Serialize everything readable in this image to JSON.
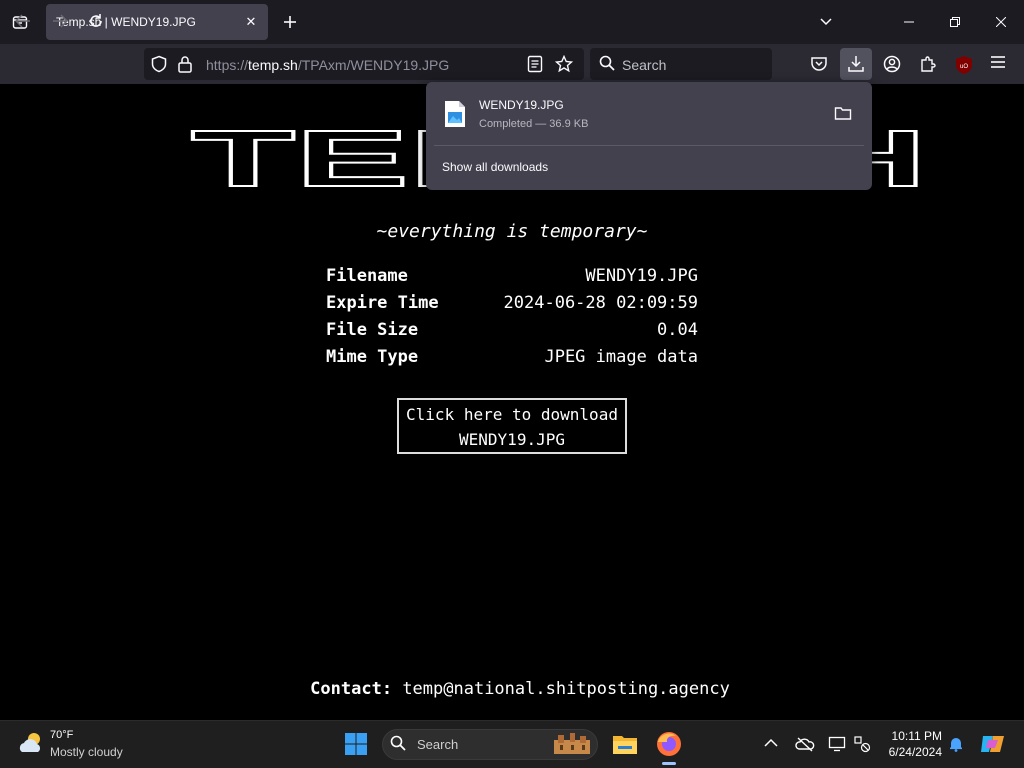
{
  "browser": {
    "tab_title": "Temp.sh | WENDY19.JPG",
    "url_prefix": "https://",
    "url_host": "temp.sh",
    "url_path": "/TPAxm/WENDY19.JPG",
    "search_placeholder": "Search"
  },
  "downloads_panel": {
    "file_name": "WENDY19.JPG",
    "status": "Completed — 36.9 KB",
    "show_all": "Show all downloads"
  },
  "page": {
    "logo_text": "TEMP.SH",
    "tagline": "~everything is temporary~",
    "info": [
      {
        "label": "Filename",
        "value": "WENDY19.JPG"
      },
      {
        "label": "Expire Time",
        "value": "2024-06-28 02:09:59"
      },
      {
        "label": "File Size",
        "value": "0.04"
      },
      {
        "label": "Mime Type",
        "value": "JPEG image data"
      }
    ],
    "download_line1": "Click here to download",
    "download_line2": "WENDY19.JPG",
    "contact_label": "Contact:",
    "contact_email": "temp@national.shitposting.agency"
  },
  "taskbar": {
    "weather_temp": "70°F",
    "weather_desc": "Mostly cloudy",
    "search_placeholder": "Search",
    "time": "10:11 PM",
    "date": "6/24/2024"
  },
  "colors": {
    "titlebar": "#1c1b22",
    "toolbar": "#2b2a33",
    "panel": "#42414d",
    "page_bg": "#000000",
    "taskbar": "#1f1f1f"
  }
}
